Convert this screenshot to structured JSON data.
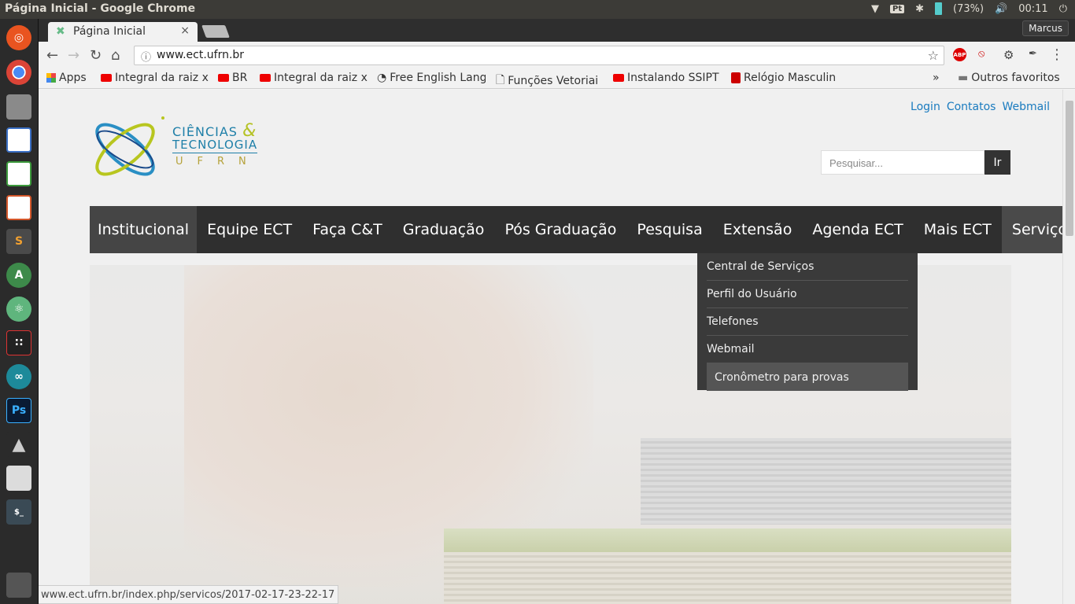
{
  "window": {
    "title": "Página Inicial - Google Chrome"
  },
  "tray": {
    "input_method": "Pt",
    "battery": "(73%)",
    "clock": "00:11"
  },
  "launcher": {
    "items": [
      "ubuntu-icon",
      "chrome-icon",
      "files-icon",
      "writer-icon",
      "calc-icon",
      "impress-icon",
      "sublime-icon",
      "android-studio-icon",
      "atom-icon",
      "redis-icon",
      "arduino-icon",
      "photoshop-icon",
      "inkscape-icon",
      "settings-icon",
      "terminal-icon",
      "trash-icon"
    ]
  },
  "browser": {
    "tab_title": "Página Inicial",
    "tab_close": "×",
    "profile": "Marcus",
    "url": "www.ect.ufrn.br",
    "bookmarks": [
      "Apps",
      "Integral da raiz x",
      "BR",
      "Integral da raiz x",
      "Free English Lang",
      "Funções Vetoriai",
      "Instalando SSIPT",
      "Relógio Masculin"
    ],
    "more_bookmarks": "»",
    "other_favorites": "Outros favoritos",
    "abp_label": "ABP"
  },
  "site": {
    "logo": {
      "line1": "CIÊNCIAS",
      "amp": "&",
      "line2": "TECNOLOGIA",
      "line3": "UFRN"
    },
    "top_links": [
      "Login",
      "Contatos",
      "Webmail"
    ],
    "search": {
      "placeholder": "Pesquisar...",
      "button": "Ir"
    },
    "nav": [
      "Institucional",
      "Equipe ECT",
      "Faça C&T",
      "Graduação",
      "Pós Graduação",
      "Pesquisa",
      "Extensão",
      "Agenda ECT",
      "Mais ECT",
      "Serviços"
    ],
    "services_menu": [
      "Central de Serviços",
      "Perfil do Usuário",
      "Telefones",
      "Webmail",
      "Cronômetro para provas"
    ]
  },
  "status_url": "www.ect.ufrn.br/index.php/servicos/2017-02-17-23-22-17"
}
